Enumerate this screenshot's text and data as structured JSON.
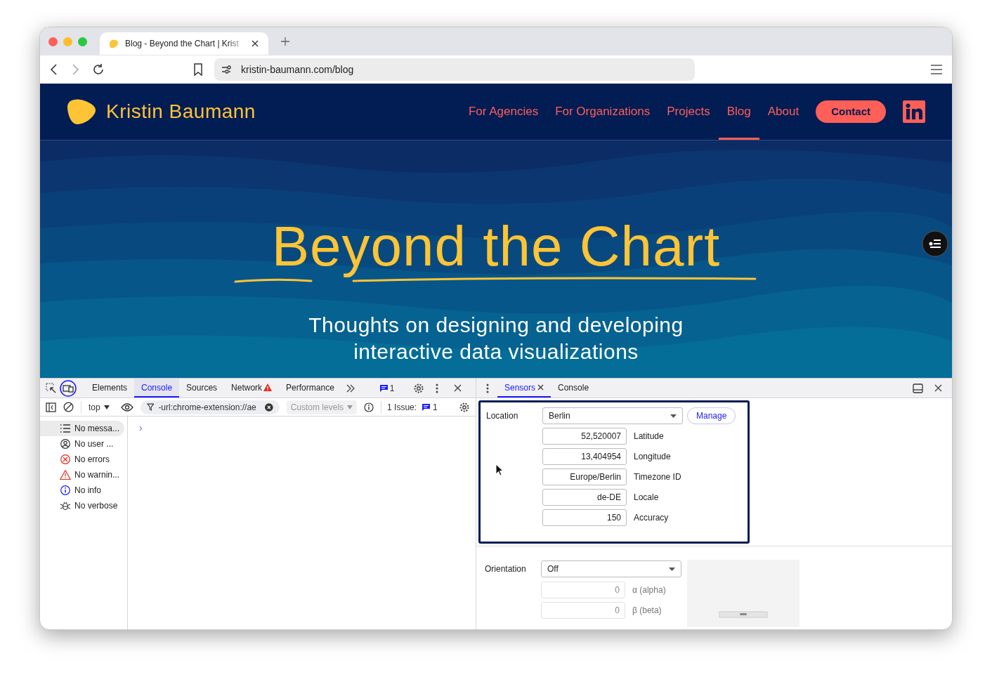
{
  "browser": {
    "tab": {
      "title": "Blog - Beyond the Chart | Krist"
    },
    "url": "kristin-baumann.com/blog"
  },
  "site": {
    "logo_text": "Kristin Baumann",
    "nav": [
      {
        "label": "For Agencies",
        "selected": false
      },
      {
        "label": "For Organizations",
        "selected": false
      },
      {
        "label": "Projects",
        "selected": false
      },
      {
        "label": "Blog",
        "selected": true
      },
      {
        "label": "About",
        "selected": false
      }
    ],
    "contact_button": "Contact",
    "hero": {
      "title": "Beyond the Chart",
      "subtitle_lines": [
        "Thoughts on designing and developing",
        "interactive data visualizations"
      ]
    }
  },
  "devtools": {
    "left": {
      "tabs": [
        {
          "label": "Elements",
          "selected": false,
          "warning": false
        },
        {
          "label": "Console",
          "selected": true,
          "warning": false
        },
        {
          "label": "Sources",
          "selected": false,
          "warning": false
        },
        {
          "label": "Network",
          "selected": false,
          "warning": true
        },
        {
          "label": "Performance",
          "selected": false,
          "warning": false
        }
      ],
      "issues_badge": "1",
      "toolbar": {
        "context": "top",
        "filter": "-url:chrome-extension://ae",
        "levels": "Custom levels",
        "issues_label": "1 Issue:",
        "issues_count": "1"
      },
      "sidebar": [
        {
          "kind": "list",
          "label": "No messa...",
          "selected": true
        },
        {
          "kind": "user",
          "label": "No user ...",
          "selected": false
        },
        {
          "kind": "error",
          "label": "No errors",
          "selected": false
        },
        {
          "kind": "warning",
          "label": "No warnin...",
          "selected": false
        },
        {
          "kind": "info",
          "label": "No info",
          "selected": false
        },
        {
          "kind": "verbose",
          "label": "No verbose",
          "selected": false
        }
      ],
      "prompt": "›"
    },
    "right": {
      "tabs": [
        {
          "label": "Sensors",
          "selected": true,
          "closable": true
        },
        {
          "label": "Console",
          "selected": false,
          "closable": false
        }
      ],
      "location": {
        "label": "Location",
        "select": "Berlin",
        "manage": "Manage",
        "fields": [
          {
            "value": "52,520007",
            "label": "Latitude"
          },
          {
            "value": "13,404954",
            "label": "Longitude"
          },
          {
            "value": "Europe/Berlin",
            "label": "Timezone ID"
          },
          {
            "value": "de-DE",
            "label": "Locale"
          },
          {
            "value": "150",
            "label": "Accuracy"
          }
        ]
      },
      "orientation": {
        "label": "Orientation",
        "select": "Off",
        "disabled": true,
        "fields": [
          {
            "value": "0",
            "label": "α (alpha)"
          },
          {
            "value": "0",
            "label": "β (beta)"
          }
        ]
      }
    }
  }
}
